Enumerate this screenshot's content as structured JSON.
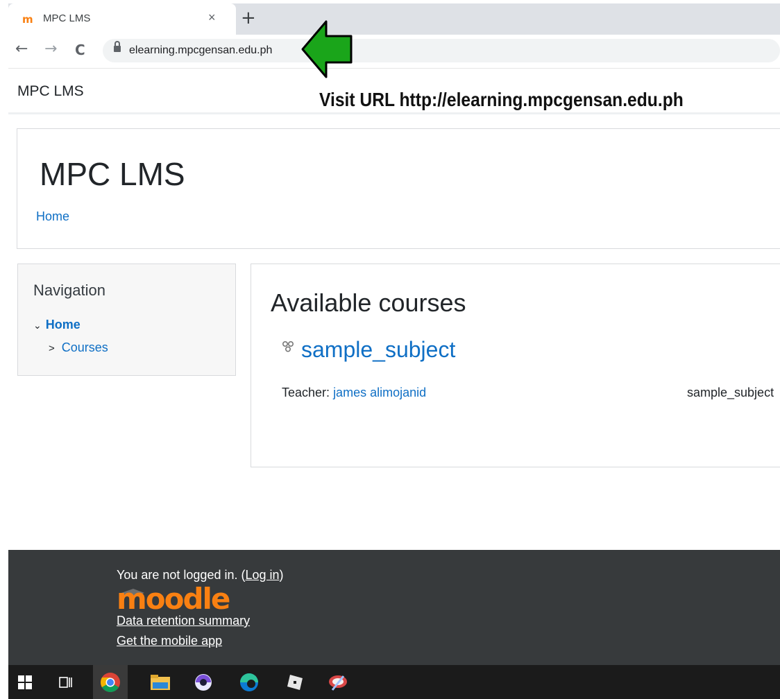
{
  "browser": {
    "tab_title": "MPC LMS",
    "tab_close": "×",
    "new_tab": "+",
    "favicon": "m",
    "url": "elearning.mpcgensan.edu.ph",
    "back": "←",
    "forward": "→",
    "reload": "C"
  },
  "annotation": {
    "text": "Visit URL http://elearning.mpcgensan.edu.ph",
    "arrow_color": "#1aa51a"
  },
  "navbar": {
    "site_name": "MPC LMS"
  },
  "header": {
    "title": "MPC LMS",
    "breadcrumb": "Home"
  },
  "navigation": {
    "heading": "Navigation",
    "home_chevron": "⌄",
    "home": "Home",
    "courses_chevron": ">",
    "courses": "Courses"
  },
  "main": {
    "heading": "Available courses",
    "course": {
      "name": "sample_subject",
      "teacher_label": "Teacher:",
      "teacher_name": "james alimojanid",
      "category": "sample_subject"
    }
  },
  "footer": {
    "not_logged_in": "You are not logged in.",
    "login_open": " (",
    "login_link": "Log in",
    "login_close": ")",
    "logo_text": "moodle",
    "data_retention": "Data retention summary",
    "mobile_app": "Get the mobile app"
  },
  "colors": {
    "link": "#0f6fc5",
    "footer_bg": "#373a3c",
    "moodle_orange": "#f98012",
    "taskbar_bg": "#1b1b1b"
  },
  "taskbar": {
    "items": [
      "windows-start-icon",
      "task-view-icon",
      "chrome-icon",
      "file-explorer-icon",
      "app-icon",
      "edge-icon",
      "roblox-icon",
      "snipping-tool-icon"
    ]
  }
}
